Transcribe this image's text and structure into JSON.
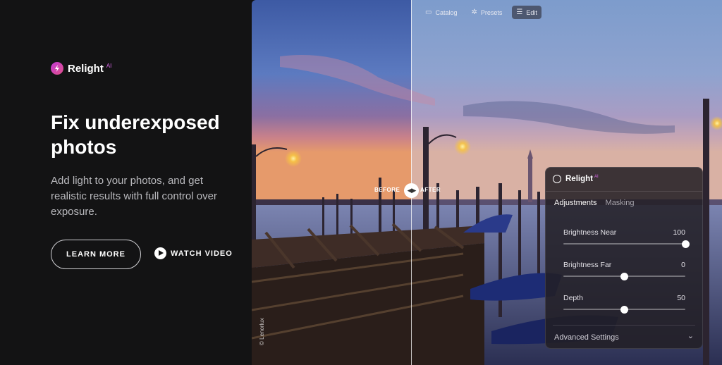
{
  "brand": {
    "name": "Relight",
    "ai": "AI",
    "icon": "relight-logo-icon",
    "accent": "#d866e8"
  },
  "hero": {
    "headline": "Fix underexposed photos",
    "subtext": "Add light to your photos, and get realistic results with full control over exposure.",
    "learn_more": "LEARN MORE",
    "watch_video": "WATCH VIDEO"
  },
  "photo_nav": {
    "catalog": "Catalog",
    "presets": "Presets",
    "edit": "Edit"
  },
  "compare": {
    "before": "BEFORE",
    "after": "AFTER",
    "credit": "© Lenorlux"
  },
  "panel": {
    "title": "Relight",
    "ai": "AI",
    "tabs": [
      {
        "label": "Adjustments",
        "active": true
      },
      {
        "label": "Masking",
        "active": false
      }
    ],
    "sliders": [
      {
        "label": "Brightness Near",
        "value": "100",
        "fraction": 1.0
      },
      {
        "label": "Brightness Far",
        "value": "0",
        "fraction": 0.5
      },
      {
        "label": "Depth",
        "value": "50",
        "fraction": 0.5
      }
    ],
    "advanced": "Advanced Settings"
  }
}
